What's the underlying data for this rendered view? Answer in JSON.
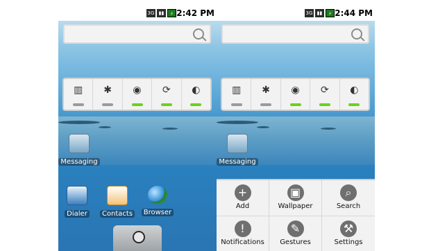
{
  "left_screen": {
    "status": {
      "time": "2:42 PM",
      "icons": [
        "3g-icon",
        "signal-icon",
        "battery-icon"
      ]
    },
    "search": {
      "placeholder": ""
    },
    "power_widget": {
      "items": [
        {
          "name": "wifi-toggle-icon",
          "glyph": "▥",
          "active": false
        },
        {
          "name": "bluetooth-toggle-icon",
          "glyph": "✱",
          "active": false
        },
        {
          "name": "gps-toggle-icon",
          "glyph": "◉",
          "active": true
        },
        {
          "name": "sync-toggle-icon",
          "glyph": "⟳",
          "active": true
        },
        {
          "name": "brightness-toggle-icon",
          "glyph": "◐",
          "active": true
        }
      ]
    },
    "apps": {
      "messaging": "Messaging",
      "dialer": "Dialer",
      "contacts": "Contacts",
      "browser": "Browser"
    }
  },
  "right_screen": {
    "status": {
      "time": "2:44 PM",
      "icons": [
        "3g-icon",
        "signal-icon",
        "battery-icon"
      ]
    },
    "search": {
      "placeholder": ""
    },
    "power_widget": {
      "items": [
        {
          "name": "wifi-toggle-icon",
          "glyph": "▥",
          "active": false
        },
        {
          "name": "bluetooth-toggle-icon",
          "glyph": "✱",
          "active": false
        },
        {
          "name": "gps-toggle-icon",
          "glyph": "◉",
          "active": true
        },
        {
          "name": "sync-toggle-icon",
          "glyph": "⟳",
          "active": true
        },
        {
          "name": "brightness-toggle-icon",
          "glyph": "◐",
          "active": true
        }
      ]
    },
    "apps": {
      "messaging": "Messaging"
    },
    "menu": {
      "items": [
        {
          "label": "Add",
          "icon": "add-icon",
          "glyph": "+"
        },
        {
          "label": "Wallpaper",
          "icon": "wallpaper-icon",
          "glyph": "▣"
        },
        {
          "label": "Search",
          "icon": "search-icon",
          "glyph": "⌕"
        },
        {
          "label": "Notifications",
          "icon": "notifications-icon",
          "glyph": "!"
        },
        {
          "label": "Gestures",
          "icon": "gestures-icon",
          "glyph": "✎"
        },
        {
          "label": "Settings",
          "icon": "settings-icon",
          "glyph": "⚒"
        }
      ]
    }
  }
}
